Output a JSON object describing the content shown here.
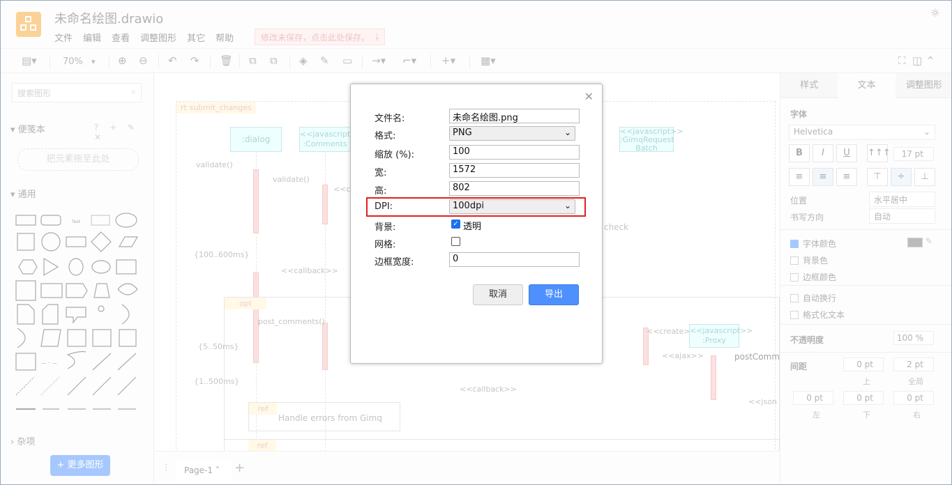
{
  "app": {
    "title": "未命名绘图.drawio",
    "menu": [
      "文件",
      "编辑",
      "查看",
      "调整图形",
      "其它",
      "帮助"
    ],
    "unsaved_notice": "修改未保存，点击此处保存。"
  },
  "toolbar": {
    "zoom": "70%"
  },
  "sidebar": {
    "search_placeholder": "搜索图形",
    "scratchpad_title": "便笺本",
    "scratchpad_icons": "? + ✎ ✕",
    "dropzone": "把元素拖至此处",
    "general_title": "通用",
    "misc_title": "杂项",
    "more_shapes": "+ 更多图形"
  },
  "canvas": {
    "labels": {
      "submit": "rt submit_changes",
      "dialog": ":dialog",
      "comments": "<<javascript>>\n:Comments",
      "gimq": "<<javascript>>\n:GimqRequest\nBatch",
      "validate1": "validate()",
      "validate2": "validate()",
      "cr": "<<cr",
      "range1": "{100..600ms}",
      "callback1": "<<callback>>",
      "opt": "opt",
      "post": "post_comments()",
      "range2": "{5..50ms}",
      "create": "<<create>>",
      "proxy": "<<javascript>>\n:Proxy",
      "ajax": "<<ajax>>",
      "postcomm": "postComm",
      "range3": "{1..500ms}",
      "callback2": "<<callback>>",
      "json": "<<json",
      "ref": "ref",
      "handle": "Handle errors from Gimq",
      "ref2": "ref",
      "check": "check"
    },
    "page_tab": "Page-1"
  },
  "format_panel": {
    "tabs": [
      "样式",
      "文本",
      "调整图形"
    ],
    "font_label": "字体",
    "font_value": "Helvetica",
    "font_size": "17 pt",
    "position_label": "位置",
    "position_value": "水平居中",
    "direction_label": "书写方向",
    "direction_value": "自动",
    "font_color": "字体颜色",
    "bg_color": "背景色",
    "border_color": "边框颜色",
    "wrap": "自动换行",
    "formatted": "格式化文本",
    "opacity_label": "不透明度",
    "opacity_value": "100 %",
    "spacing_label": "间距",
    "spacing_top": "0 pt",
    "spacing_all": "2 pt",
    "sub_top": "上",
    "sub_all": "全局",
    "spacing_left": "0 pt",
    "spacing_bottom": "0 pt",
    "spacing_right": "0 pt",
    "sub_left": "左",
    "sub_bottom": "下",
    "sub_right": "右"
  },
  "dialog": {
    "filename_label": "文件名:",
    "filename_value": "未命名绘图.png",
    "format_label": "格式:",
    "format_value": "PNG",
    "zoom_label": "缩放 (%):",
    "zoom_value": "100",
    "width_label": "宽:",
    "width_value": "1572",
    "height_label": "高:",
    "height_value": "802",
    "dpi_label": "DPI:",
    "dpi_value": "100dpi",
    "background_label": "背景:",
    "transparent_label": "透明",
    "grid_label": "网格:",
    "border_label": "边框宽度:",
    "border_value": "0",
    "cancel": "取消",
    "export": "导出"
  }
}
